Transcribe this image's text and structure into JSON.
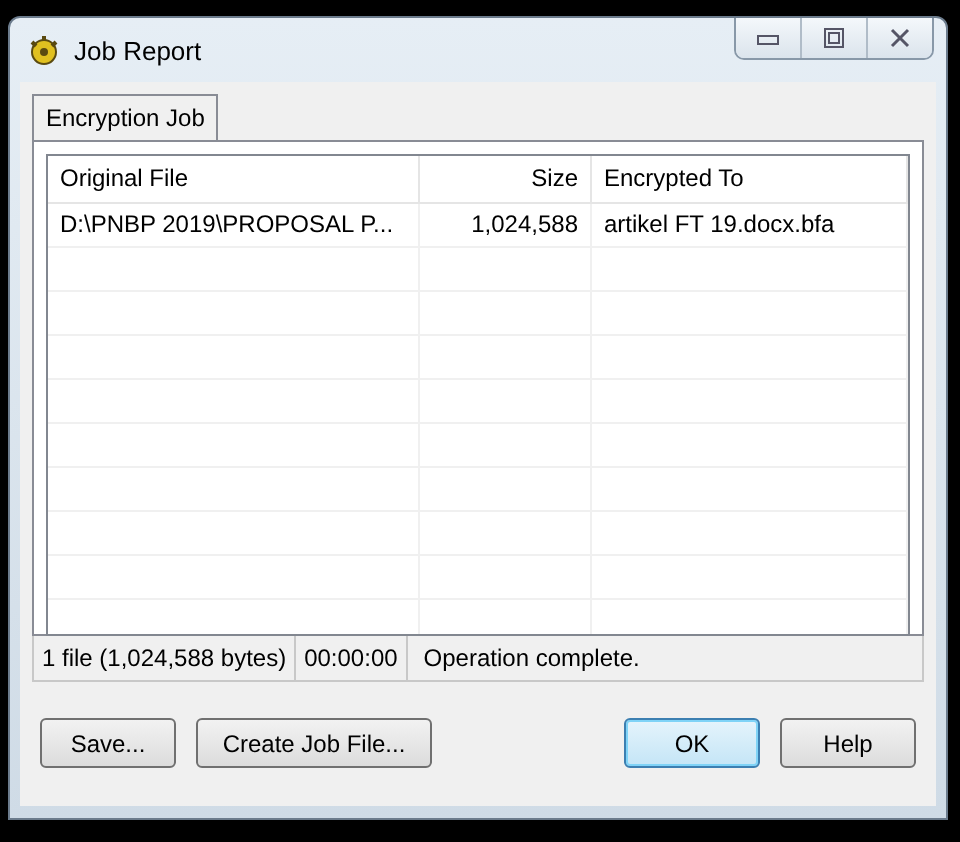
{
  "window": {
    "title": "Job Report"
  },
  "tabs": [
    {
      "label": "Encryption Job",
      "selected": true
    }
  ],
  "table": {
    "columns": [
      "Original File",
      "Size",
      "Encrypted To"
    ],
    "rows": [
      [
        "D:\\PNBP 2019\\PROPOSAL P...",
        "1,024,588",
        "artikel FT 19.docx.bfa"
      ]
    ]
  },
  "status_bar": [
    "1 file (1,024,588 bytes)",
    "00:00:00",
    "Operation complete."
  ],
  "buttons": [
    {
      "label": "Save...",
      "default": false
    },
    {
      "label": "Create Job File...",
      "default": false
    },
    {
      "label": "OK",
      "default": true
    },
    {
      "label": "Help",
      "default": false
    }
  ]
}
